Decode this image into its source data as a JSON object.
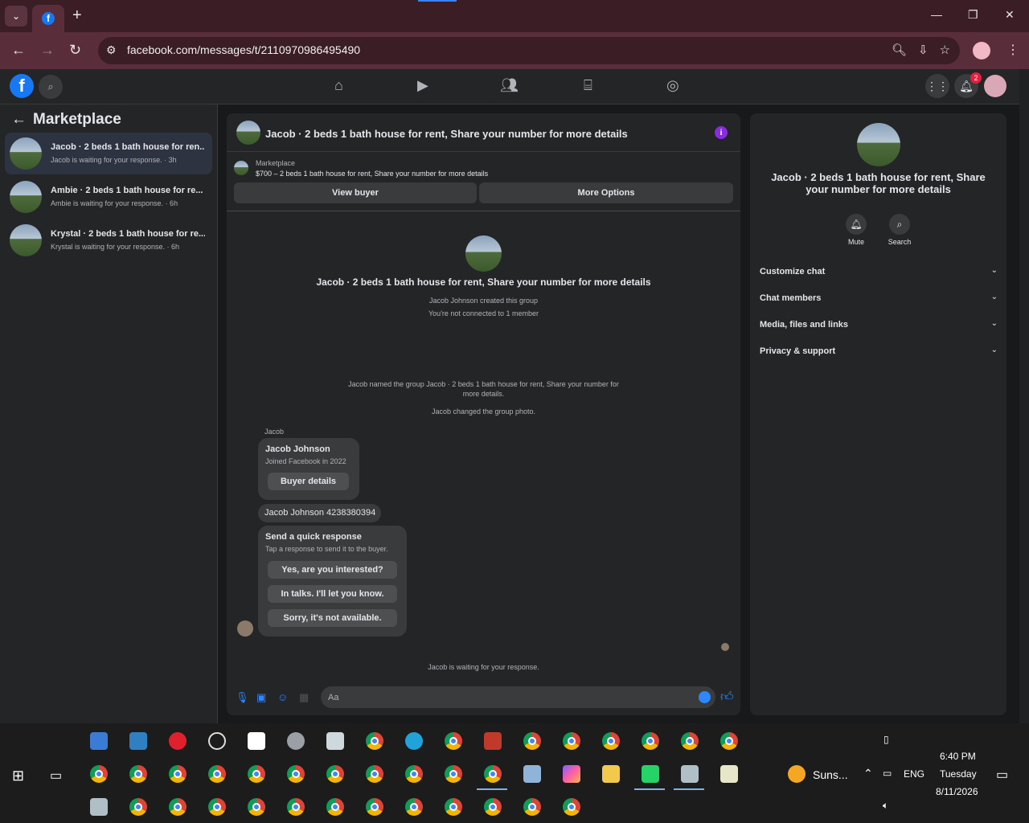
{
  "browser": {
    "url": "facebook.com/messages/t/2110970986495490",
    "new_tab": "+",
    "min": "—",
    "restore": "❐",
    "close": "✕"
  },
  "fb_header": {
    "logo": "f",
    "notification_count": "2"
  },
  "sidebar": {
    "title": "Marketplace",
    "conversations": [
      {
        "title": "Jacob · 2 beds 1 bath house for ren...",
        "subtitle": "Jacob is waiting for your response. · 3h",
        "selected": true
      },
      {
        "title": "Ambie · 2 beds 1 bath house for re...",
        "subtitle": "Ambie is waiting for your response. · 6h",
        "selected": false
      },
      {
        "title": "Krystal · 2 beds 1 bath house for re...",
        "subtitle": "Krystal is waiting for your response. · 6h",
        "selected": false
      }
    ]
  },
  "chat": {
    "header_title": "Jacob · 2 beds 1 bath house for rent, Share your number for more details",
    "marketplace_label": "Marketplace",
    "listing": "$700 – 2 beds 1 bath house for rent, Share your number for more details",
    "view_buyer": "View buyer",
    "more_options": "More Options",
    "group_title": "Jacob · 2 beds 1 bath house for rent, Share your number for more details",
    "created": "Jacob Johnson created this group",
    "not_connected": "You're not connected to 1 member",
    "named_group": "Jacob named the group Jacob · 2 beds 1 bath house for rent, Share your number for more details.",
    "changed_photo": "Jacob changed the group photo.",
    "sender": "Jacob",
    "card_name": "Jacob Johnson",
    "card_joined": "Joined Facebook in 2022",
    "buyer_details": "Buyer details",
    "phone_msg": "Jacob Johnson 4238380394",
    "quick_title": "Send a quick response",
    "quick_sub": "Tap a response to send it to the buyer.",
    "quick_1": "Yes, are you interested?",
    "quick_2": "In talks. I'll let you know.",
    "quick_3": "Sorry, it's not available.",
    "waiting": "Jacob is waiting for your response.",
    "composer_placeholder": "Aa"
  },
  "right_panel": {
    "title": "Jacob · 2 beds 1 bath house for rent, Share your number for more details",
    "mute": "Mute",
    "search": "Search",
    "rows": [
      "Customize chat",
      "Chat members",
      "Media, files and links",
      "Privacy & support"
    ]
  },
  "taskbar": {
    "weather": "Suns...",
    "lang": "ENG",
    "time": "6:40 PM",
    "day": "Tuesday",
    "date": "8/11/2026"
  },
  "colors": {
    "fb_blue": "#1877f2",
    "messenger_blue": "#2d88ff",
    "info_purple": "#8a2be2",
    "badge_red": "#e41e3f"
  }
}
